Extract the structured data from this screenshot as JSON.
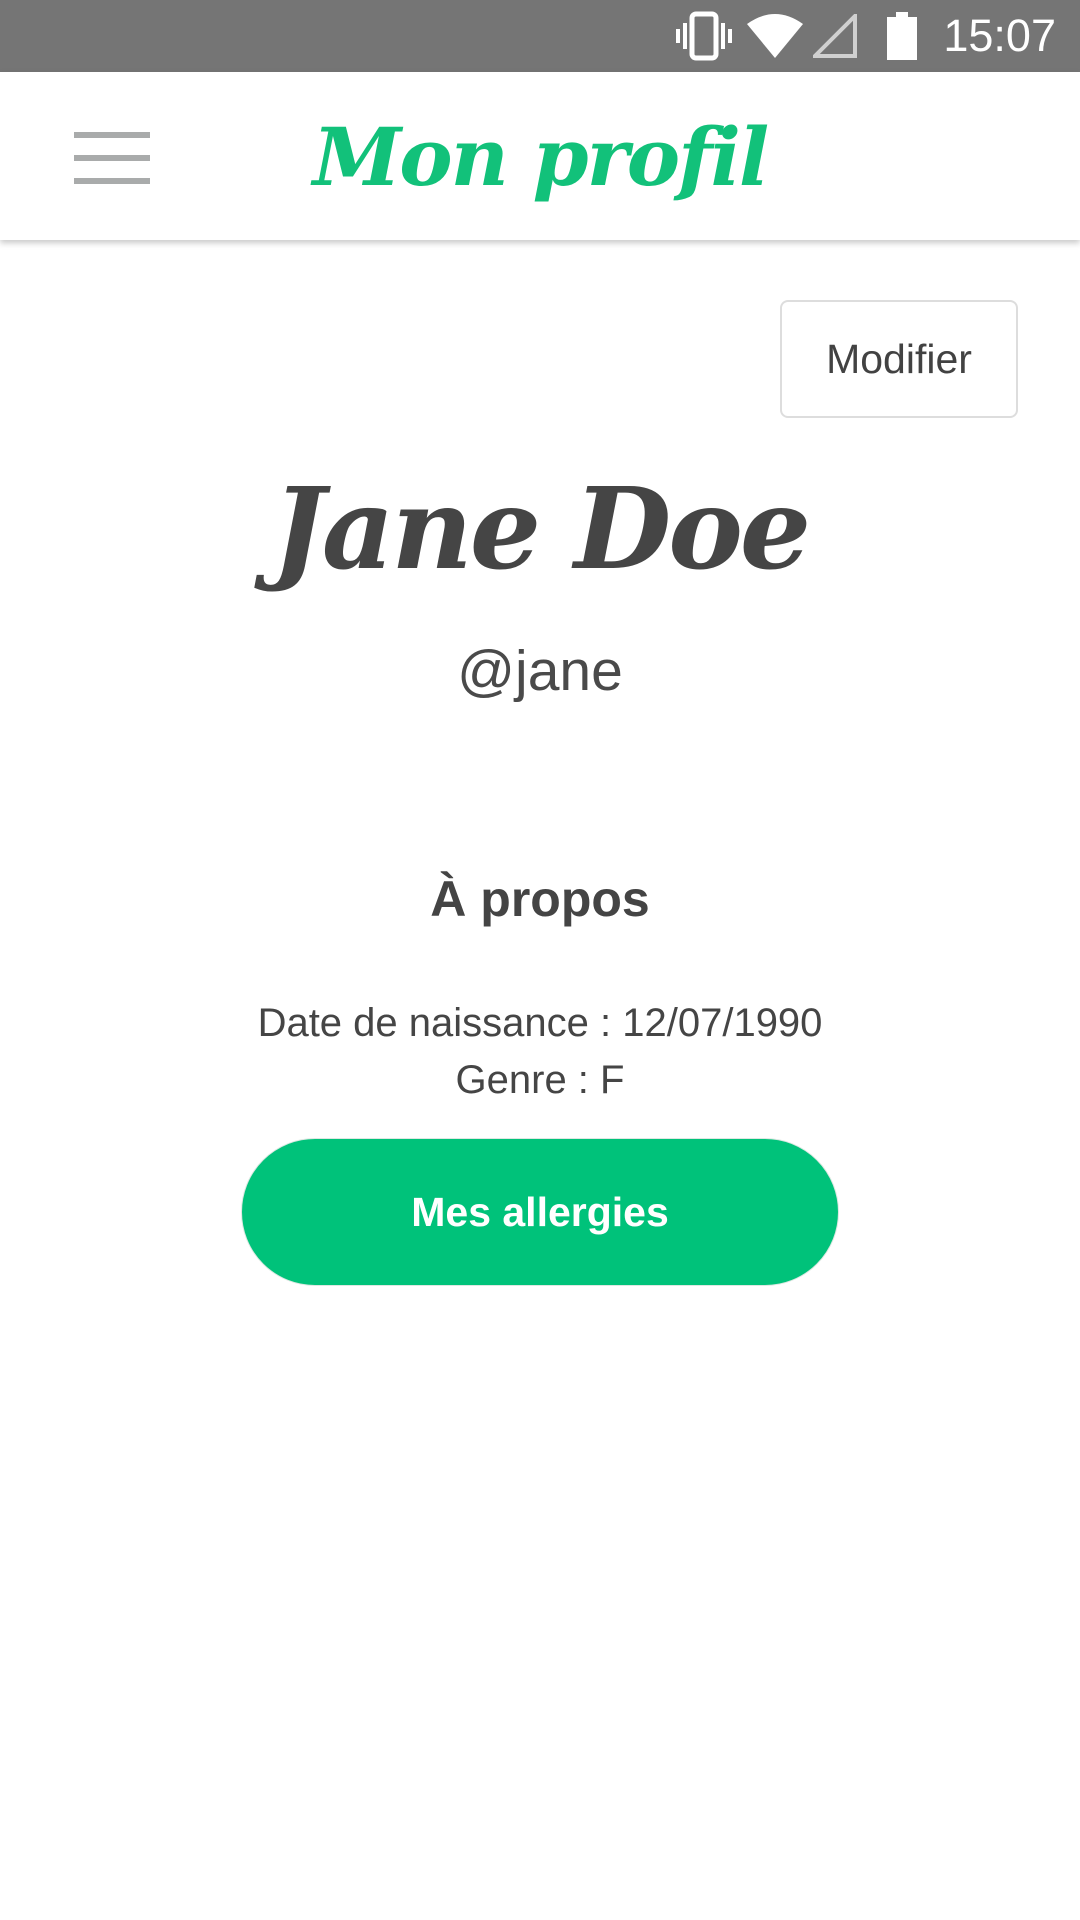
{
  "status_bar": {
    "time": "15:07",
    "icons": [
      "vibrate-icon",
      "wifi-icon",
      "cellular-signal-icon",
      "battery-icon"
    ]
  },
  "app_bar": {
    "title": "Mon profil",
    "menu_icon": "hamburger-menu-icon"
  },
  "profile": {
    "modify_label": "Modifier",
    "full_name": "Jane Doe",
    "username": "@jane"
  },
  "about": {
    "heading": "À propos",
    "birthdate_line": "Date de naissance : 12/07/1990",
    "gender_line": "Genre : F"
  },
  "actions": {
    "allergies_label": "Mes allergies"
  },
  "colors": {
    "accent": "#00c27a",
    "title_green": "#12c17a",
    "status_bar": "#757575",
    "text_dark": "#454545",
    "menu_icon": "#a9abab"
  }
}
